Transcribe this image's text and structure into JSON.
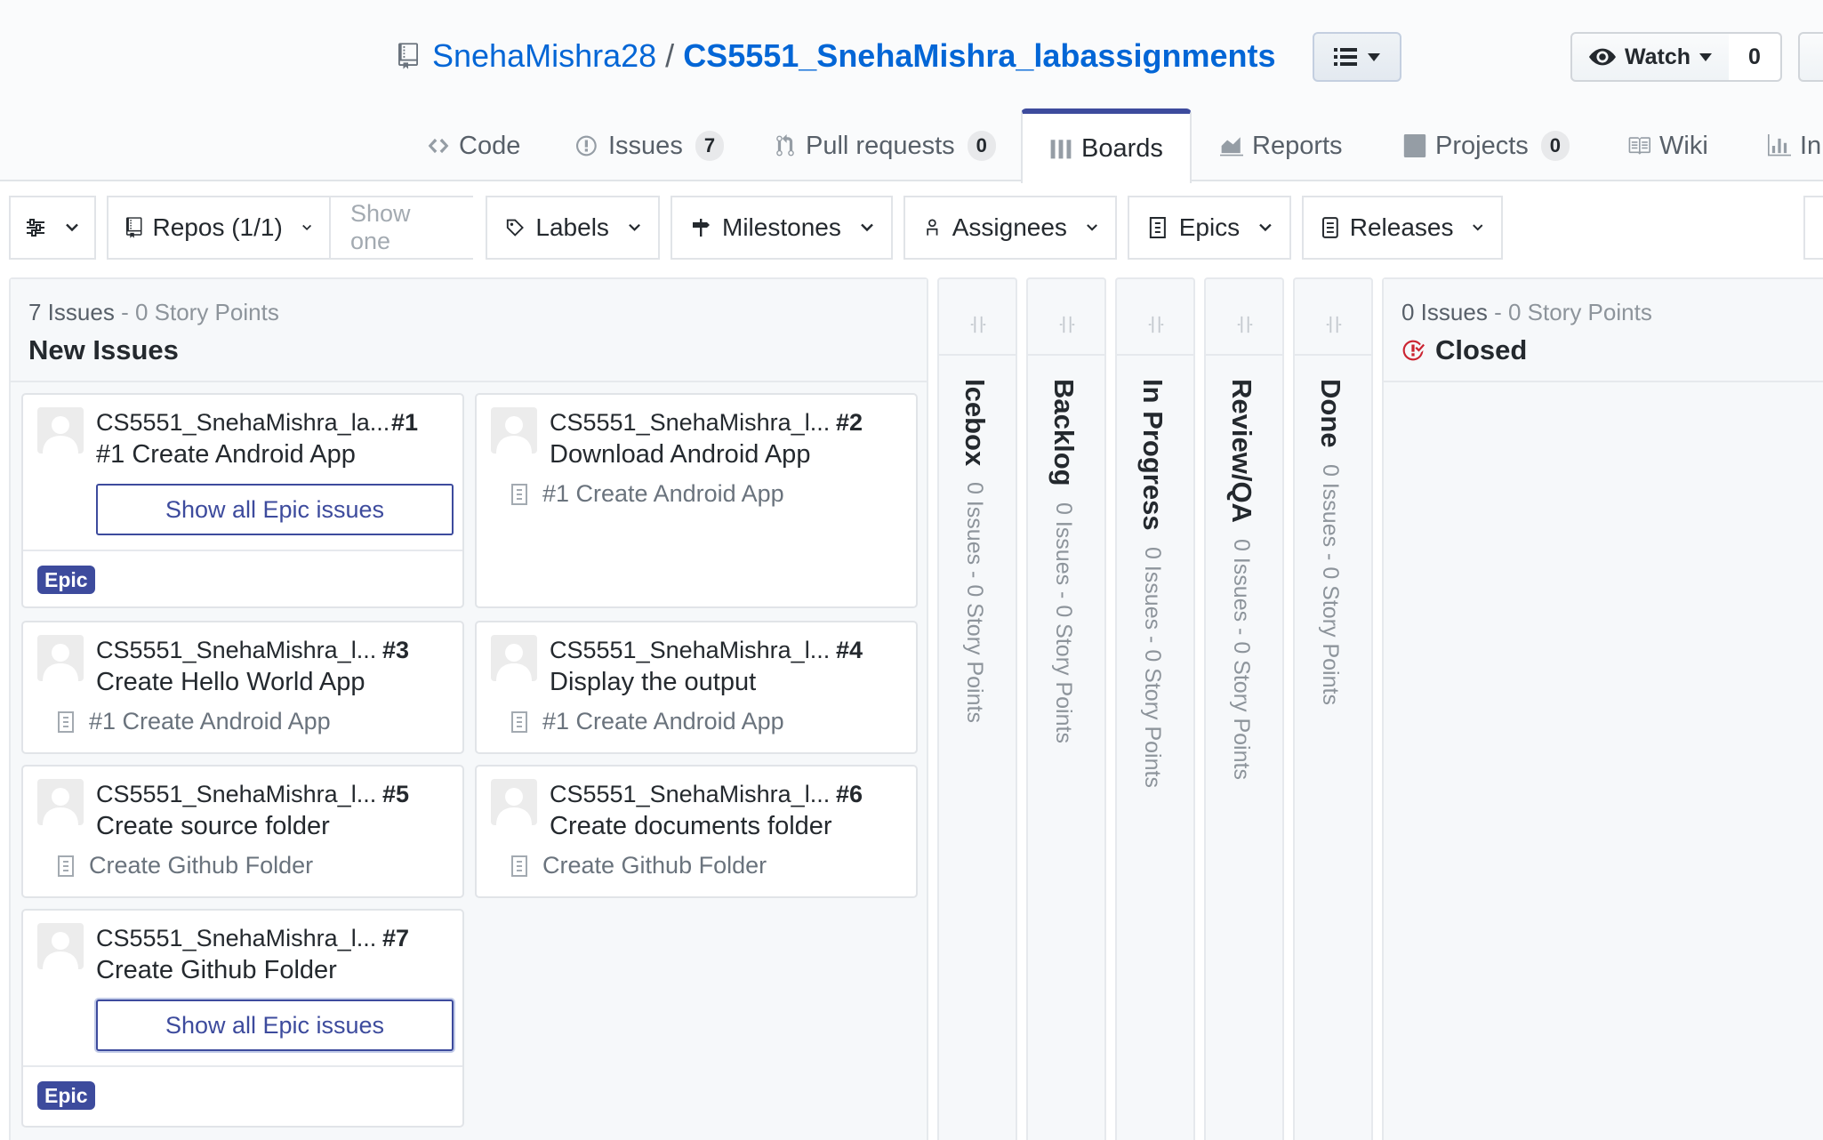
{
  "repo": {
    "owner": "SnehaMishra28",
    "separator": "/",
    "name": "CS5551_SnehaMishra_labassignments"
  },
  "actions": {
    "watch_label": "Watch",
    "watch_count": "0"
  },
  "tabs": [
    {
      "label": "Code",
      "icon": "code-icon"
    },
    {
      "label": "Issues",
      "count": "7",
      "icon": "issue-opened-icon"
    },
    {
      "label": "Pull requests",
      "count": "0",
      "icon": "git-pull-request-icon"
    },
    {
      "label": "Boards",
      "icon": "boards-icon",
      "selected": true
    },
    {
      "label": "Reports",
      "icon": "graph-icon"
    },
    {
      "label": "Projects",
      "count": "0",
      "icon": "project-icon"
    },
    {
      "label": "Wiki",
      "icon": "book-icon"
    },
    {
      "label": "In",
      "icon": "insights-icon"
    }
  ],
  "toolbar": {
    "filters_icon": "sliders-icon",
    "repos_label": "Repos (1/1)",
    "show_one_placeholder": "Show one",
    "labels_label": "Labels",
    "milestones_label": "Milestones",
    "assignees_label": "Assignees",
    "epics_label": "Epics",
    "releases_label": "Releases"
  },
  "board": {
    "new_issues": {
      "count_text": "7 Issues",
      "dash": "-",
      "points_text": "0 Story Points",
      "name": "New Issues"
    },
    "collapsed": [
      {
        "name": "Icebox",
        "meta": "0 Issues - 0 Story Points"
      },
      {
        "name": "Backlog",
        "meta": "0 Issues - 0 Story Points"
      },
      {
        "name": "In Progress",
        "meta": "0 Issues - 0 Story Points"
      },
      {
        "name": "Review/QA",
        "meta": "0 Issues - 0 Story Points"
      },
      {
        "name": "Done",
        "meta": "0 Issues - 0 Story Points"
      }
    ],
    "closed": {
      "count_text": "0 Issues",
      "dash": "-",
      "points_text": "0 Story Points",
      "name": "Closed"
    },
    "show_epic_label": "Show all Epic issues",
    "epic_badge": "Epic",
    "cards": [
      {
        "repo": "CS5551_SnehaMishra_la...",
        "number": "#1",
        "title": "#1 Create Android App",
        "is_epic": true
      },
      {
        "repo": "CS5551_SnehaMishra_l...",
        "number": "#2",
        "title": "Download Android App",
        "epic": "#1 Create Android App"
      },
      {
        "repo": "CS5551_SnehaMishra_l...",
        "number": "#3",
        "title": "Create Hello World App",
        "epic": "#1 Create Android App"
      },
      {
        "repo": "CS5551_SnehaMishra_l...",
        "number": "#4",
        "title": "Display the output",
        "epic": "#1 Create Android App"
      },
      {
        "repo": "CS5551_SnehaMishra_l...",
        "number": "#5",
        "title": "Create source folder",
        "epic": "Create Github Folder"
      },
      {
        "repo": "CS5551_SnehaMishra_l...",
        "number": "#6",
        "title": "Create documents folder",
        "epic": "Create Github Folder"
      },
      {
        "repo": "CS5551_SnehaMishra_l...",
        "number": "#7",
        "title": "Create Github Folder",
        "is_epic": true
      }
    ]
  },
  "colors": {
    "link": "#0366d6",
    "zenhub_accent": "#3d4b9d",
    "closed_red": "#cb2431",
    "muted": "#586069"
  }
}
